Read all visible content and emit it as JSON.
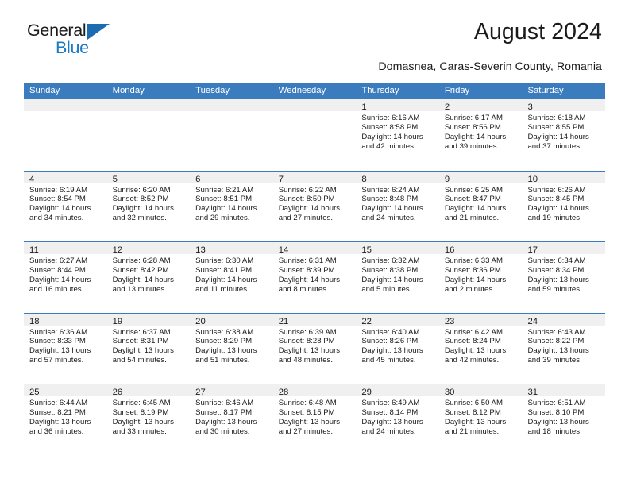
{
  "brand": {
    "name_part1": "General",
    "name_part2": "Blue",
    "accent_color": "#1b7ac4",
    "header_color": "#3a7cbd"
  },
  "header": {
    "title": "August 2024",
    "subtitle": "Domasnea, Caras-Severin County, Romania"
  },
  "calendar": {
    "day_headers": [
      "Sunday",
      "Monday",
      "Tuesday",
      "Wednesday",
      "Thursday",
      "Friday",
      "Saturday"
    ],
    "weeks": [
      [
        {
          "day": "",
          "sunrise": "",
          "sunset": "",
          "daylight": "",
          "empty": true
        },
        {
          "day": "",
          "sunrise": "",
          "sunset": "",
          "daylight": "",
          "empty": true
        },
        {
          "day": "",
          "sunrise": "",
          "sunset": "",
          "daylight": "",
          "empty": true
        },
        {
          "day": "",
          "sunrise": "",
          "sunset": "",
          "daylight": "",
          "empty": true
        },
        {
          "day": "1",
          "sunrise": "Sunrise: 6:16 AM",
          "sunset": "Sunset: 8:58 PM",
          "daylight": "Daylight: 14 hours and 42 minutes.",
          "empty": false
        },
        {
          "day": "2",
          "sunrise": "Sunrise: 6:17 AM",
          "sunset": "Sunset: 8:56 PM",
          "daylight": "Daylight: 14 hours and 39 minutes.",
          "empty": false
        },
        {
          "day": "3",
          "sunrise": "Sunrise: 6:18 AM",
          "sunset": "Sunset: 8:55 PM",
          "daylight": "Daylight: 14 hours and 37 minutes.",
          "empty": false
        }
      ],
      [
        {
          "day": "4",
          "sunrise": "Sunrise: 6:19 AM",
          "sunset": "Sunset: 8:54 PM",
          "daylight": "Daylight: 14 hours and 34 minutes.",
          "empty": false
        },
        {
          "day": "5",
          "sunrise": "Sunrise: 6:20 AM",
          "sunset": "Sunset: 8:52 PM",
          "daylight": "Daylight: 14 hours and 32 minutes.",
          "empty": false
        },
        {
          "day": "6",
          "sunrise": "Sunrise: 6:21 AM",
          "sunset": "Sunset: 8:51 PM",
          "daylight": "Daylight: 14 hours and 29 minutes.",
          "empty": false
        },
        {
          "day": "7",
          "sunrise": "Sunrise: 6:22 AM",
          "sunset": "Sunset: 8:50 PM",
          "daylight": "Daylight: 14 hours and 27 minutes.",
          "empty": false
        },
        {
          "day": "8",
          "sunrise": "Sunrise: 6:24 AM",
          "sunset": "Sunset: 8:48 PM",
          "daylight": "Daylight: 14 hours and 24 minutes.",
          "empty": false
        },
        {
          "day": "9",
          "sunrise": "Sunrise: 6:25 AM",
          "sunset": "Sunset: 8:47 PM",
          "daylight": "Daylight: 14 hours and 21 minutes.",
          "empty": false
        },
        {
          "day": "10",
          "sunrise": "Sunrise: 6:26 AM",
          "sunset": "Sunset: 8:45 PM",
          "daylight": "Daylight: 14 hours and 19 minutes.",
          "empty": false
        }
      ],
      [
        {
          "day": "11",
          "sunrise": "Sunrise: 6:27 AM",
          "sunset": "Sunset: 8:44 PM",
          "daylight": "Daylight: 14 hours and 16 minutes.",
          "empty": false
        },
        {
          "day": "12",
          "sunrise": "Sunrise: 6:28 AM",
          "sunset": "Sunset: 8:42 PM",
          "daylight": "Daylight: 14 hours and 13 minutes.",
          "empty": false
        },
        {
          "day": "13",
          "sunrise": "Sunrise: 6:30 AM",
          "sunset": "Sunset: 8:41 PM",
          "daylight": "Daylight: 14 hours and 11 minutes.",
          "empty": false
        },
        {
          "day": "14",
          "sunrise": "Sunrise: 6:31 AM",
          "sunset": "Sunset: 8:39 PM",
          "daylight": "Daylight: 14 hours and 8 minutes.",
          "empty": false
        },
        {
          "day": "15",
          "sunrise": "Sunrise: 6:32 AM",
          "sunset": "Sunset: 8:38 PM",
          "daylight": "Daylight: 14 hours and 5 minutes.",
          "empty": false
        },
        {
          "day": "16",
          "sunrise": "Sunrise: 6:33 AM",
          "sunset": "Sunset: 8:36 PM",
          "daylight": "Daylight: 14 hours and 2 minutes.",
          "empty": false
        },
        {
          "day": "17",
          "sunrise": "Sunrise: 6:34 AM",
          "sunset": "Sunset: 8:34 PM",
          "daylight": "Daylight: 13 hours and 59 minutes.",
          "empty": false
        }
      ],
      [
        {
          "day": "18",
          "sunrise": "Sunrise: 6:36 AM",
          "sunset": "Sunset: 8:33 PM",
          "daylight": "Daylight: 13 hours and 57 minutes.",
          "empty": false
        },
        {
          "day": "19",
          "sunrise": "Sunrise: 6:37 AM",
          "sunset": "Sunset: 8:31 PM",
          "daylight": "Daylight: 13 hours and 54 minutes.",
          "empty": false
        },
        {
          "day": "20",
          "sunrise": "Sunrise: 6:38 AM",
          "sunset": "Sunset: 8:29 PM",
          "daylight": "Daylight: 13 hours and 51 minutes.",
          "empty": false
        },
        {
          "day": "21",
          "sunrise": "Sunrise: 6:39 AM",
          "sunset": "Sunset: 8:28 PM",
          "daylight": "Daylight: 13 hours and 48 minutes.",
          "empty": false
        },
        {
          "day": "22",
          "sunrise": "Sunrise: 6:40 AM",
          "sunset": "Sunset: 8:26 PM",
          "daylight": "Daylight: 13 hours and 45 minutes.",
          "empty": false
        },
        {
          "day": "23",
          "sunrise": "Sunrise: 6:42 AM",
          "sunset": "Sunset: 8:24 PM",
          "daylight": "Daylight: 13 hours and 42 minutes.",
          "empty": false
        },
        {
          "day": "24",
          "sunrise": "Sunrise: 6:43 AM",
          "sunset": "Sunset: 8:22 PM",
          "daylight": "Daylight: 13 hours and 39 minutes.",
          "empty": false
        }
      ],
      [
        {
          "day": "25",
          "sunrise": "Sunrise: 6:44 AM",
          "sunset": "Sunset: 8:21 PM",
          "daylight": "Daylight: 13 hours and 36 minutes.",
          "empty": false
        },
        {
          "day": "26",
          "sunrise": "Sunrise: 6:45 AM",
          "sunset": "Sunset: 8:19 PM",
          "daylight": "Daylight: 13 hours and 33 minutes.",
          "empty": false
        },
        {
          "day": "27",
          "sunrise": "Sunrise: 6:46 AM",
          "sunset": "Sunset: 8:17 PM",
          "daylight": "Daylight: 13 hours and 30 minutes.",
          "empty": false
        },
        {
          "day": "28",
          "sunrise": "Sunrise: 6:48 AM",
          "sunset": "Sunset: 8:15 PM",
          "daylight": "Daylight: 13 hours and 27 minutes.",
          "empty": false
        },
        {
          "day": "29",
          "sunrise": "Sunrise: 6:49 AM",
          "sunset": "Sunset: 8:14 PM",
          "daylight": "Daylight: 13 hours and 24 minutes.",
          "empty": false
        },
        {
          "day": "30",
          "sunrise": "Sunrise: 6:50 AM",
          "sunset": "Sunset: 8:12 PM",
          "daylight": "Daylight: 13 hours and 21 minutes.",
          "empty": false
        },
        {
          "day": "31",
          "sunrise": "Sunrise: 6:51 AM",
          "sunset": "Sunset: 8:10 PM",
          "daylight": "Daylight: 13 hours and 18 minutes.",
          "empty": false
        }
      ]
    ]
  }
}
